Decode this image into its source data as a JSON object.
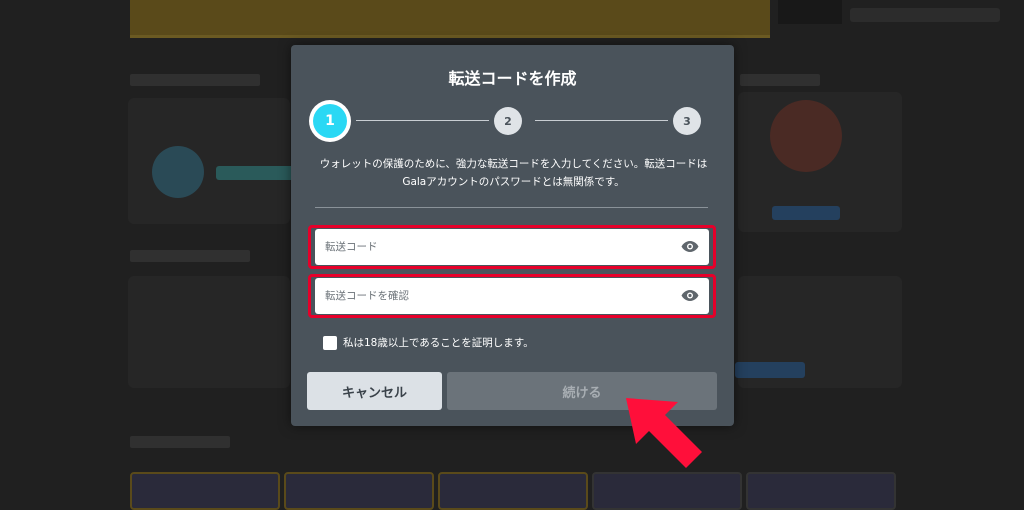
{
  "modal": {
    "title": "転送コードを作成",
    "steps": [
      "1",
      "2",
      "3"
    ],
    "description": "ウォレットの保護のために、強力な転送コードを入力してください。転送コードはGalaアカウントのパスワードとは無関係です。",
    "transfer_code_placeholder": "転送コード",
    "confirm_code_placeholder": "転送コードを確認",
    "age_check_label": "私は18歳以上であることを証明します。",
    "cancel_label": "キャンセル",
    "continue_label": "続ける"
  },
  "colors": {
    "modal_bg": "#4a535b",
    "active_step": "#2ad8f4",
    "highlight_red": "#e6002a",
    "disabled_button": "#6b737a"
  },
  "icons": [
    "eye-icon",
    "red-arrow-pointer"
  ]
}
